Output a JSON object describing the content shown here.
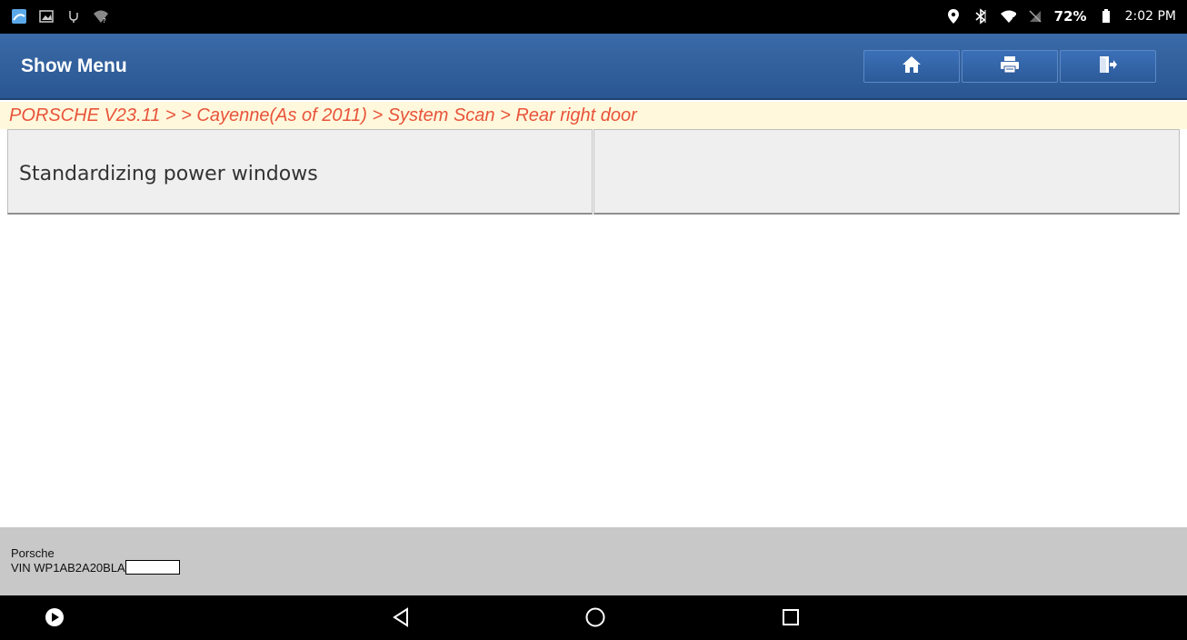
{
  "status_bar": {
    "left_icons": [
      "app-icon",
      "image-icon",
      "usb-icon",
      "wifi-unknown-icon"
    ],
    "right_icons": [
      "location-icon",
      "bluetooth-icon",
      "wifi-icon",
      "no-signal-icon"
    ],
    "battery": "72%",
    "time": "2:02 PM"
  },
  "header": {
    "title": "Show Menu",
    "buttons": [
      "home-icon",
      "print-icon",
      "exit-icon"
    ]
  },
  "breadcrumb": "PORSCHE V23.11 >  > Cayenne(As of 2011) > System Scan > Rear right door",
  "menu": {
    "items": [
      {
        "label": "Standardizing power windows"
      },
      {
        "label": ""
      }
    ]
  },
  "footer": {
    "make": "Porsche",
    "vin": "VIN WP1AB2A20BLA"
  },
  "nav_bar": {
    "buttons": [
      "play-icon",
      "back-icon",
      "home-circle-icon",
      "recents-icon"
    ]
  },
  "colors": {
    "header_bg": "#2d5c9a",
    "breadcrumb_text": "#e8533a",
    "breadcrumb_bg": "#fff8dc"
  }
}
